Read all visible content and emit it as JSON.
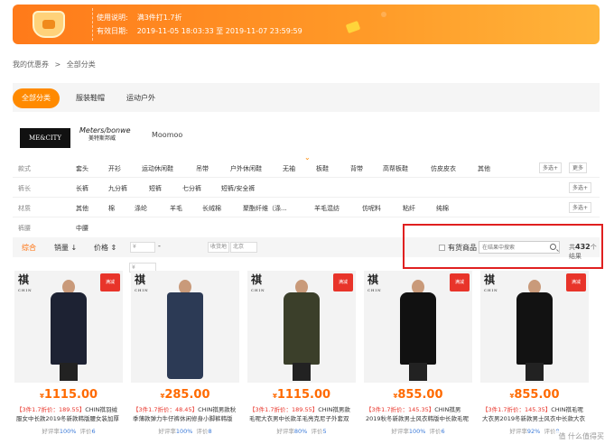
{
  "banner": {
    "usage_label": "使用说明:",
    "usage_value": "满3件打1.7折",
    "valid_label": "有效日期:",
    "valid_value": "2019-11-05 18:03:33 至 2019-11-07 23:59:59"
  },
  "breadcrumb": {
    "item1": "我的优惠券",
    "sep": ">",
    "item2": "全部分类"
  },
  "tabs": [
    {
      "label": "全部分类",
      "active": true
    },
    {
      "label": "服装鞋帽",
      "active": false
    },
    {
      "label": "运动户外",
      "active": false
    }
  ],
  "brands": {
    "mes": "ME&CITY",
    "mb": "Meters/bonwe",
    "mb_cn": "美特斯邦威",
    "moo": "Moomoo"
  },
  "filters": [
    {
      "label": "款式",
      "options": [
        "套头",
        "开衫",
        "运动休闲鞋",
        "吊带",
        "户外休闲鞋",
        "无袖",
        "板鞋",
        "背带",
        "高帮板鞋",
        "仿皮皮衣",
        "其他"
      ],
      "more": "多选+",
      "expand": "更多"
    },
    {
      "label": "裤长",
      "options": [
        "长裤",
        "九分裤",
        "短裤",
        "七分裤",
        "短裤/安全裤"
      ],
      "more": "多选+"
    },
    {
      "label": "材质",
      "options": [
        "其他",
        "棉",
        "涤纶",
        "羊毛",
        "长绒棉",
        "聚酯纤维（涤...",
        "羊毛混纺",
        "仿呢料",
        "粘纤",
        "纯棉"
      ],
      "more": "多选+"
    },
    {
      "label": "裤腰",
      "options": [
        "中腰"
      ]
    }
  ],
  "sortbar": {
    "default": "综合",
    "sales": "销量 ↓",
    "price": "价格 ⇕",
    "price_from": "¥",
    "dash": "-",
    "shipfrom_label": "收货地",
    "shipfrom_value": "北京",
    "in_stock": "有货商品",
    "search_placeholder": "在结果中搜索",
    "count_prefix": "共",
    "count": "432",
    "count_suffix": "个结果",
    "price_to": "¥"
  },
  "products": [
    {
      "price": "1115.00",
      "desc_hl": "【3件1.7折价：189.55】",
      "desc": "CHIN祺羽绒服女中长款2019冬新款韩版腰女装加厚宽",
      "good_label": "好评率",
      "good": "100%",
      "review_label": "评价",
      "reviews": "6",
      "coat": "#1d2233"
    },
    {
      "price": "285.00",
      "desc_hl": "【3件1.7折价：48.45】",
      "desc": "CHIN祺男款秋季薄款弹力牛仔裤休闲修身小脚裤韩版简直",
      "good_label": "好评率",
      "good": "100%",
      "review_label": "评价",
      "reviews": "8",
      "coat": "#2c3a55"
    },
    {
      "price": "1115.00",
      "desc_hl": "【3件1.7折价：189.55】",
      "desc": "CHIN祺男款毛呢大衣男中长款羊毛亮克尼子外套双面呢",
      "good_label": "好评率",
      "good": "80%",
      "review_label": "评价",
      "reviews": "5",
      "coat": "#3b3f2a"
    },
    {
      "price": "855.00",
      "desc_hl": "【3件1.7折价：145.35】",
      "desc": "CHIN祺男2019秋冬新款男士风衣韩版中长款毛呢大衣男修",
      "good_label": "好评率",
      "good": "100%",
      "review_label": "评价",
      "reviews": "6",
      "coat": "#111111"
    },
    {
      "price": "855.00",
      "desc_hl": "【3件1.7折价：145.35】",
      "desc": "CHIN祺毛呢大衣男2019冬新款男士风衣中长款大衣",
      "good_label": "好评率",
      "good": "92%",
      "review_label": "评价",
      "reviews": "8",
      "coat": "#121212"
    }
  ],
  "badge_text": "满减",
  "logo_text": "祺",
  "logo_sub": "CHIN",
  "watermark": "值 什么值得买"
}
